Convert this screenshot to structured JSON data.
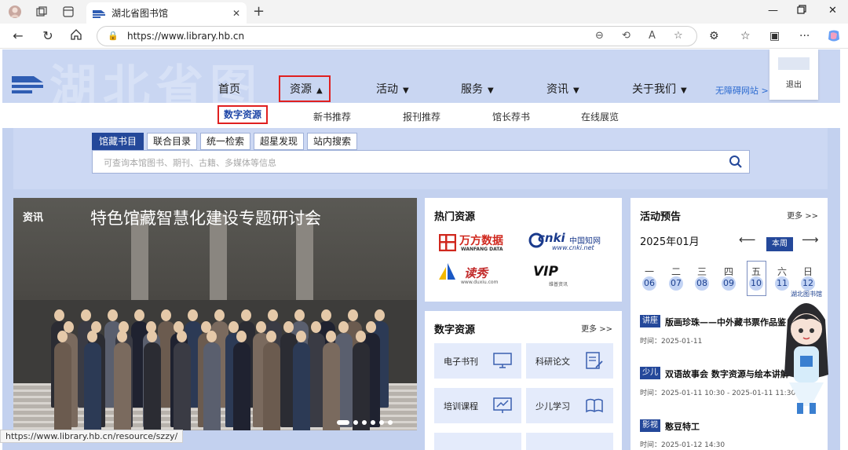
{
  "browser": {
    "tab_title": "湖北省图书馆",
    "url": "https://www.library.hb.cn",
    "status_url": "https://www.library.hb.cn/resource/szzy/"
  },
  "header": {
    "decor_text": "湖北省图",
    "nav": [
      "首页",
      "资源",
      "活动",
      "服务",
      "资讯",
      "关于我们"
    ],
    "accessibility_link": "无障碍网站 >",
    "logout": "退出"
  },
  "subnav": {
    "items": [
      "数字资源",
      "新书推荐",
      "报刊推荐",
      "馆长荐书",
      "在线展览"
    ]
  },
  "search": {
    "tabs": [
      "馆藏书目",
      "联合目录",
      "统一检索",
      "超星发现",
      "站内搜索"
    ],
    "placeholder": "可查询本馆图书、期刊、古籍、多媒体等信息"
  },
  "news": {
    "label": "资讯",
    "title": "特色馆藏智慧化建设专题研讨会"
  },
  "hot_resources": {
    "title": "热门资源",
    "wanfang_cn": "万方数据",
    "wanfang_en": "WANFANG DATA",
    "cnki": "cnki",
    "cnki_cn": "中国知网",
    "cnki_url": "www.cnki.net",
    "duxiu": "读秀",
    "duxiu_url": "www.duxiu.com",
    "vip": "VIP",
    "vip_cn": "维普资讯"
  },
  "digital_resources": {
    "title": "数字资源",
    "more": "更多 >>",
    "tiles": [
      "电子书刊",
      "科研论文",
      "培训课程",
      "少儿学习"
    ]
  },
  "activities": {
    "title": "活动预告",
    "more": "更多 >>",
    "month": "2025年01月",
    "week_button": "本周",
    "weekdays": [
      "一",
      "二",
      "三",
      "四",
      "五",
      "六",
      "日"
    ],
    "days": [
      "06",
      "07",
      "08",
      "09",
      "10",
      "11",
      "12"
    ],
    "events": [
      {
        "tag": "讲座",
        "title": "版画珍珠——中外藏书票作品鉴",
        "time": "时间：2025-01-11"
      },
      {
        "tag": "少儿",
        "title": "双语故事会 数字资源与绘本讲解",
        "time": "时间：2025-01-11 10:30 - 2025-01-11 11:30"
      },
      {
        "tag": "影视",
        "title": "憨豆特工",
        "time": "时间：2025-01-12 14:30"
      }
    ]
  },
  "mascot": {
    "badge_text": "湖北图书馆"
  },
  "colors": {
    "brand_blue": "#24489a",
    "highlight_red": "#e02020",
    "page_bg": "#c3d1ef"
  }
}
